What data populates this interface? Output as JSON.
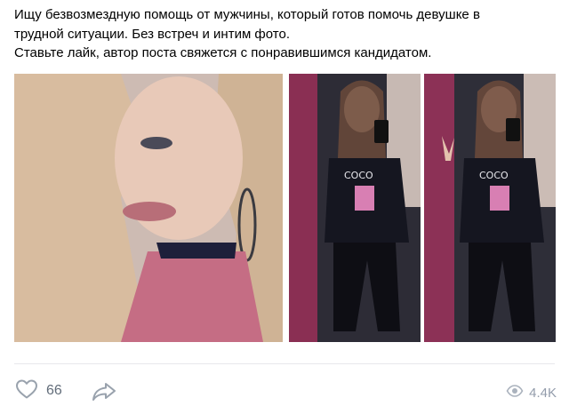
{
  "post": {
    "text_lines": [
      "Ищу безвозмездную помощь от мужчины, который готов помочь девушке в",
      "трудной ситуации. Без встреч и интим фото.",
      "Ставьте лайк, автор поста свяжется с понравившимся кандидатом."
    ],
    "photos": [
      {
        "name": "photo-selfie-closeup"
      },
      {
        "name": "photo-mirror-selfie-smiling"
      },
      {
        "name": "photo-mirror-selfie-peace-sign"
      }
    ]
  },
  "footer": {
    "like_icon": "heart-icon",
    "like_count": "66",
    "share_icon": "share-arrow-icon",
    "views_icon": "eye-icon",
    "views_count": "4.4K"
  },
  "colors": {
    "text": "#000000",
    "muted": "#626d7a",
    "icon": "#99a2ad",
    "divider": "#e7e8ec"
  }
}
